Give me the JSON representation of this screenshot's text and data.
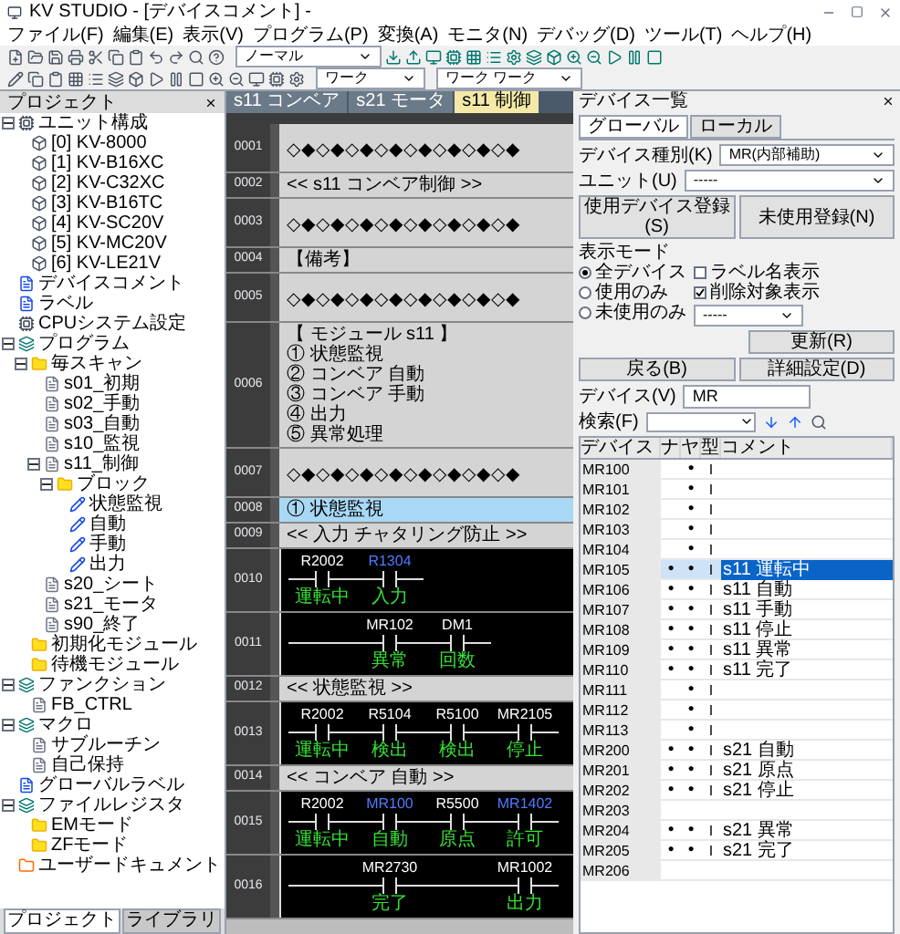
{
  "window": {
    "title": "KV STUDIO - [デバイスコメント] -"
  },
  "menu": [
    "ファイル(F)",
    "編集(E)",
    "表示(V)",
    "プログラム(P)",
    "変換(A)",
    "モニタ(N)",
    "デバッグ(D)",
    "ツール(T)",
    "ヘルプ(H)"
  ],
  "toolbar": {
    "combo_1": "ノーマル",
    "combo_2": "ワーク",
    "combo_3": "ワーク ワーク"
  },
  "left_pane": {
    "title": "プロジェクト",
    "tree": [
      {
        "label": "ユニット構成",
        "kind": "unit",
        "expanded": true,
        "children": [
          {
            "label": "[0] KV-8000",
            "kind": "slot"
          },
          {
            "label": "[1] KV-B16XC",
            "kind": "slot"
          },
          {
            "label": "[2] KV-C32XC",
            "kind": "slot"
          },
          {
            "label": "[3] KV-B16TC",
            "kind": "slot"
          },
          {
            "label": "[4] KV-SC20V",
            "kind": "slot"
          },
          {
            "label": "[5] KV-MC20V",
            "kind": "slot"
          },
          {
            "label": "[6] KV-LE21V",
            "kind": "slot"
          }
        ]
      },
      {
        "label": "デバイスコメント",
        "kind": "doc"
      },
      {
        "label": "ラベル",
        "kind": "doc"
      },
      {
        "label": "CPUシステム設定",
        "kind": "unit"
      },
      {
        "label": "プログラム",
        "kind": "program",
        "expanded": true,
        "children": [
          {
            "label": "毎スキャン",
            "kind": "folder",
            "expanded": true,
            "children": [
              {
                "label": "s01_初期",
                "kind": "module"
              },
              {
                "label": "s02_手動",
                "kind": "module"
              },
              {
                "label": "s03_自動",
                "kind": "module"
              },
              {
                "label": "s10_監視",
                "kind": "module"
              },
              {
                "label": "s11_制御",
                "kind": "module",
                "expanded": true,
                "children": [
                  {
                    "label": "ブロック",
                    "kind": "folder",
                    "expanded": true,
                    "children": [
                      {
                        "label": "状態監視",
                        "kind": "block"
                      },
                      {
                        "label": "自動",
                        "kind": "block"
                      },
                      {
                        "label": "手動",
                        "kind": "block"
                      },
                      {
                        "label": "出力",
                        "kind": "block"
                      }
                    ]
                  }
                ]
              },
              {
                "label": "s20_シート",
                "kind": "module"
              },
              {
                "label": "s21_モータ",
                "kind": "module"
              },
              {
                "label": "s90_終了",
                "kind": "module"
              }
            ]
          },
          {
            "label": "初期化モジュール",
            "kind": "folder"
          },
          {
            "label": "待機モジュール",
            "kind": "folder"
          }
        ]
      },
      {
        "label": "ファンクション",
        "kind": "program",
        "expanded": true,
        "children": [
          {
            "label": "FB_CTRL",
            "kind": "module"
          }
        ]
      },
      {
        "label": "マクロ",
        "kind": "program",
        "expanded": true,
        "children": [
          {
            "label": "サブルーチン",
            "kind": "module"
          },
          {
            "label": "自己保持",
            "kind": "module"
          }
        ]
      },
      {
        "label": "グローバルラベル",
        "kind": "doc"
      },
      {
        "label": "ファイルレジスタ",
        "kind": "program",
        "expanded": true,
        "children": [
          {
            "label": "EMモード",
            "kind": "folder"
          },
          {
            "label": "ZFモード",
            "kind": "folder"
          }
        ]
      },
      {
        "label": "ユーザードキュメント",
        "kind": "user"
      }
    ],
    "bottom_tabs": [
      {
        "label": "プロジェクト",
        "selected": true
      },
      {
        "label": "ライブラリ",
        "selected": false
      }
    ]
  },
  "editor_tabs": [
    {
      "label": "s11 コンベア",
      "selected": false
    },
    {
      "label": "s21 モータ",
      "selected": false
    },
    {
      "label": "s11 制御",
      "selected": true
    }
  ],
  "ladder": [
    {
      "no": "0001",
      "kind": "stars",
      "text": "◇◆◇◆◇◆◇◆◇◆◇◆◇◆◇◆"
    },
    {
      "no": "0002",
      "kind": "comment",
      "lines": [
        "<< s11 コンベア制御 >>"
      ]
    },
    {
      "no": "0003",
      "kind": "stars",
      "text": "◇◆◇◆◇◆◇◆◇◆◇◆◇◆◇◆"
    },
    {
      "no": "0004",
      "kind": "comment",
      "lines": [
        "【備考】"
      ]
    },
    {
      "no": "0005",
      "kind": "stars",
      "text": "◇◆◇◆◇◆◇◆◇◆◇◆◇◆◇◆"
    },
    {
      "no": "0006",
      "kind": "comment",
      "lines": [
        "【 モジュール s11 】",
        "① 状態監視",
        "② コンベア 自動",
        "③ コンベア 手動",
        "④ 出力",
        "⑤ 異常処理"
      ]
    },
    {
      "no": "0007",
      "kind": "stars",
      "text": "◇◆◇◆◇◆◇◆◇◆◇◆◇◆◇◆"
    },
    {
      "no": "0008",
      "kind": "highlight",
      "lines": [
        "① 状態監視"
      ]
    },
    {
      "no": "0009",
      "kind": "comment",
      "lines": [
        "<< 入力 チャタリング防止 >>"
      ]
    },
    {
      "no": "0010",
      "kind": "rung",
      "contacts": [
        {
          "device": "R2002",
          "comment": "運転中",
          "color": "#ffffff"
        },
        {
          "device": "R1304",
          "comment": "入力",
          "color": "#4f7cff"
        }
      ]
    },
    {
      "no": "0011",
      "kind": "rung",
      "contacts": [
        {
          "kind": "wire"
        },
        {
          "kind": "contact",
          "device": "MR102",
          "comment": "異常",
          "color": "#ffffff"
        },
        {
          "device": "DM1",
          "comment": "回数",
          "color": "#ffffff"
        }
      ]
    },
    {
      "no": "0012",
      "kind": "comment",
      "lines": [
        "<< 状態監視 >>"
      ]
    },
    {
      "no": "0013",
      "kind": "rung",
      "contacts": [
        {
          "device": "R2002",
          "comment": "運転中",
          "color": "#ffffff"
        },
        {
          "device": "R5104",
          "comment": "検出",
          "color": "#ffffff"
        },
        {
          "device": "R5100",
          "comment": "検出",
          "color": "#ffffff"
        },
        {
          "device": "MR2105",
          "comment": "停止",
          "color": "#ffffff"
        }
      ]
    },
    {
      "no": "0014",
      "kind": "comment",
      "lines": [
        "<< コンベア 自動 >>"
      ]
    },
    {
      "no": "0015",
      "kind": "rung",
      "contacts": [
        {
          "device": "R2002",
          "comment": "運転中",
          "color": "#ffffff"
        },
        {
          "device": "MR100",
          "comment": "自動",
          "color": "#4f7cff"
        },
        {
          "device": "R5500",
          "comment": "原点",
          "color": "#ffffff"
        },
        {
          "device": "MR1402",
          "comment": "許可",
          "color": "#4f7cff"
        }
      ]
    },
    {
      "no": "0016",
      "kind": "rung",
      "contacts": [
        {
          "kind": "wire"
        },
        {
          "kind": "contact",
          "device": "MR2730",
          "comment": "完了",
          "color": "#ffffff"
        },
        {
          "kind": "wire"
        },
        {
          "kind": "contact",
          "device": "MR1002",
          "comment": "出力",
          "color": "#ffffff"
        }
      ]
    }
  ],
  "right_pane": {
    "title": "デバイス一覧",
    "tabs": [
      {
        "label": "グローバル",
        "selected": true
      },
      {
        "label": "ローカル",
        "selected": false
      }
    ],
    "device_type_label": "デバイス種別(K)",
    "device_type": "MR(内部補助)",
    "unit_label": "ユニット(U)",
    "unit": "-----",
    "buttons_top": [
      "使用デバイス登録(S)",
      "未使用登録(N)"
    ],
    "mode_label": "表示モード",
    "modes": [
      {
        "label": "全デバイス",
        "selected": true
      },
      {
        "label": "使用のみ",
        "selected": false
      },
      {
        "label": "未使用のみ",
        "selected": false
      }
    ],
    "options": [
      {
        "label": "ラベル名表示",
        "checked": false
      },
      {
        "label": "削除対象表示",
        "checked": true
      }
    ],
    "option_select": "-----",
    "update_button": "更新(R)",
    "buttons_bottom": [
      "戻る(B)",
      "詳細設定(D)"
    ],
    "device_label": "デバイス(V)",
    "device_value": "MR",
    "search_label": "検索(F)",
    "columns": [
      "デバイス",
      "ナ",
      "ヤ",
      "型",
      "コメント"
    ],
    "rows": [
      {
        "device": "MR100",
        "a": "",
        "b": "●",
        "t": "I",
        "comment": "",
        "selected": false
      },
      {
        "device": "MR101",
        "a": "",
        "b": "●",
        "t": "I",
        "comment": "",
        "selected": false
      },
      {
        "device": "MR102",
        "a": "",
        "b": "●",
        "t": "I",
        "comment": "",
        "selected": false
      },
      {
        "device": "MR103",
        "a": "",
        "b": "●",
        "t": "I",
        "comment": "",
        "selected": false
      },
      {
        "device": "MR104",
        "a": "",
        "b": "●",
        "t": "I",
        "comment": "",
        "selected": false
      },
      {
        "device": "MR105",
        "a": "●",
        "b": "●",
        "t": "I",
        "comment": "s11 運転中",
        "selected": true
      },
      {
        "device": "MR106",
        "a": "●",
        "b": "●",
        "t": "I",
        "comment": "s11 自動",
        "selected": false
      },
      {
        "device": "MR107",
        "a": "●",
        "b": "●",
        "t": "I",
        "comment": "s11 手動",
        "selected": false
      },
      {
        "device": "MR108",
        "a": "●",
        "b": "●",
        "t": "I",
        "comment": "s11 停止",
        "selected": false
      },
      {
        "device": "MR109",
        "a": "●",
        "b": "●",
        "t": "I",
        "comment": "s11 異常",
        "selected": false
      },
      {
        "device": "MR110",
        "a": "●",
        "b": "●",
        "t": "I",
        "comment": "s11 完了",
        "selected": false
      },
      {
        "device": "MR111",
        "a": "",
        "b": "●",
        "t": "I",
        "comment": "",
        "selected": false
      },
      {
        "device": "MR112",
        "a": "",
        "b": "●",
        "t": "I",
        "comment": "",
        "selected": false
      },
      {
        "device": "MR113",
        "a": "",
        "b": "●",
        "t": "I",
        "comment": "",
        "selected": false
      },
      {
        "device": "MR200",
        "a": "●",
        "b": "●",
        "t": "I",
        "comment": "s21 自動",
        "selected": false
      },
      {
        "device": "MR201",
        "a": "●",
        "b": "●",
        "t": "I",
        "comment": "s21 原点",
        "selected": false
      },
      {
        "device": "MR202",
        "a": "●",
        "b": "●",
        "t": "I",
        "comment": "s21 停止",
        "selected": false
      },
      {
        "device": "MR203",
        "a": "",
        "b": "",
        "t": "",
        "comment": "",
        "selected": false
      },
      {
        "device": "MR204",
        "a": "●",
        "b": "●",
        "t": "I",
        "comment": "s21 異常",
        "selected": false
      },
      {
        "device": "MR205",
        "a": "●",
        "b": "●",
        "t": "I",
        "comment": "s21 完了",
        "selected": false
      },
      {
        "device": "MR206",
        "a": "",
        "b": "",
        "t": "",
        "comment": "",
        "selected": false
      }
    ]
  }
}
